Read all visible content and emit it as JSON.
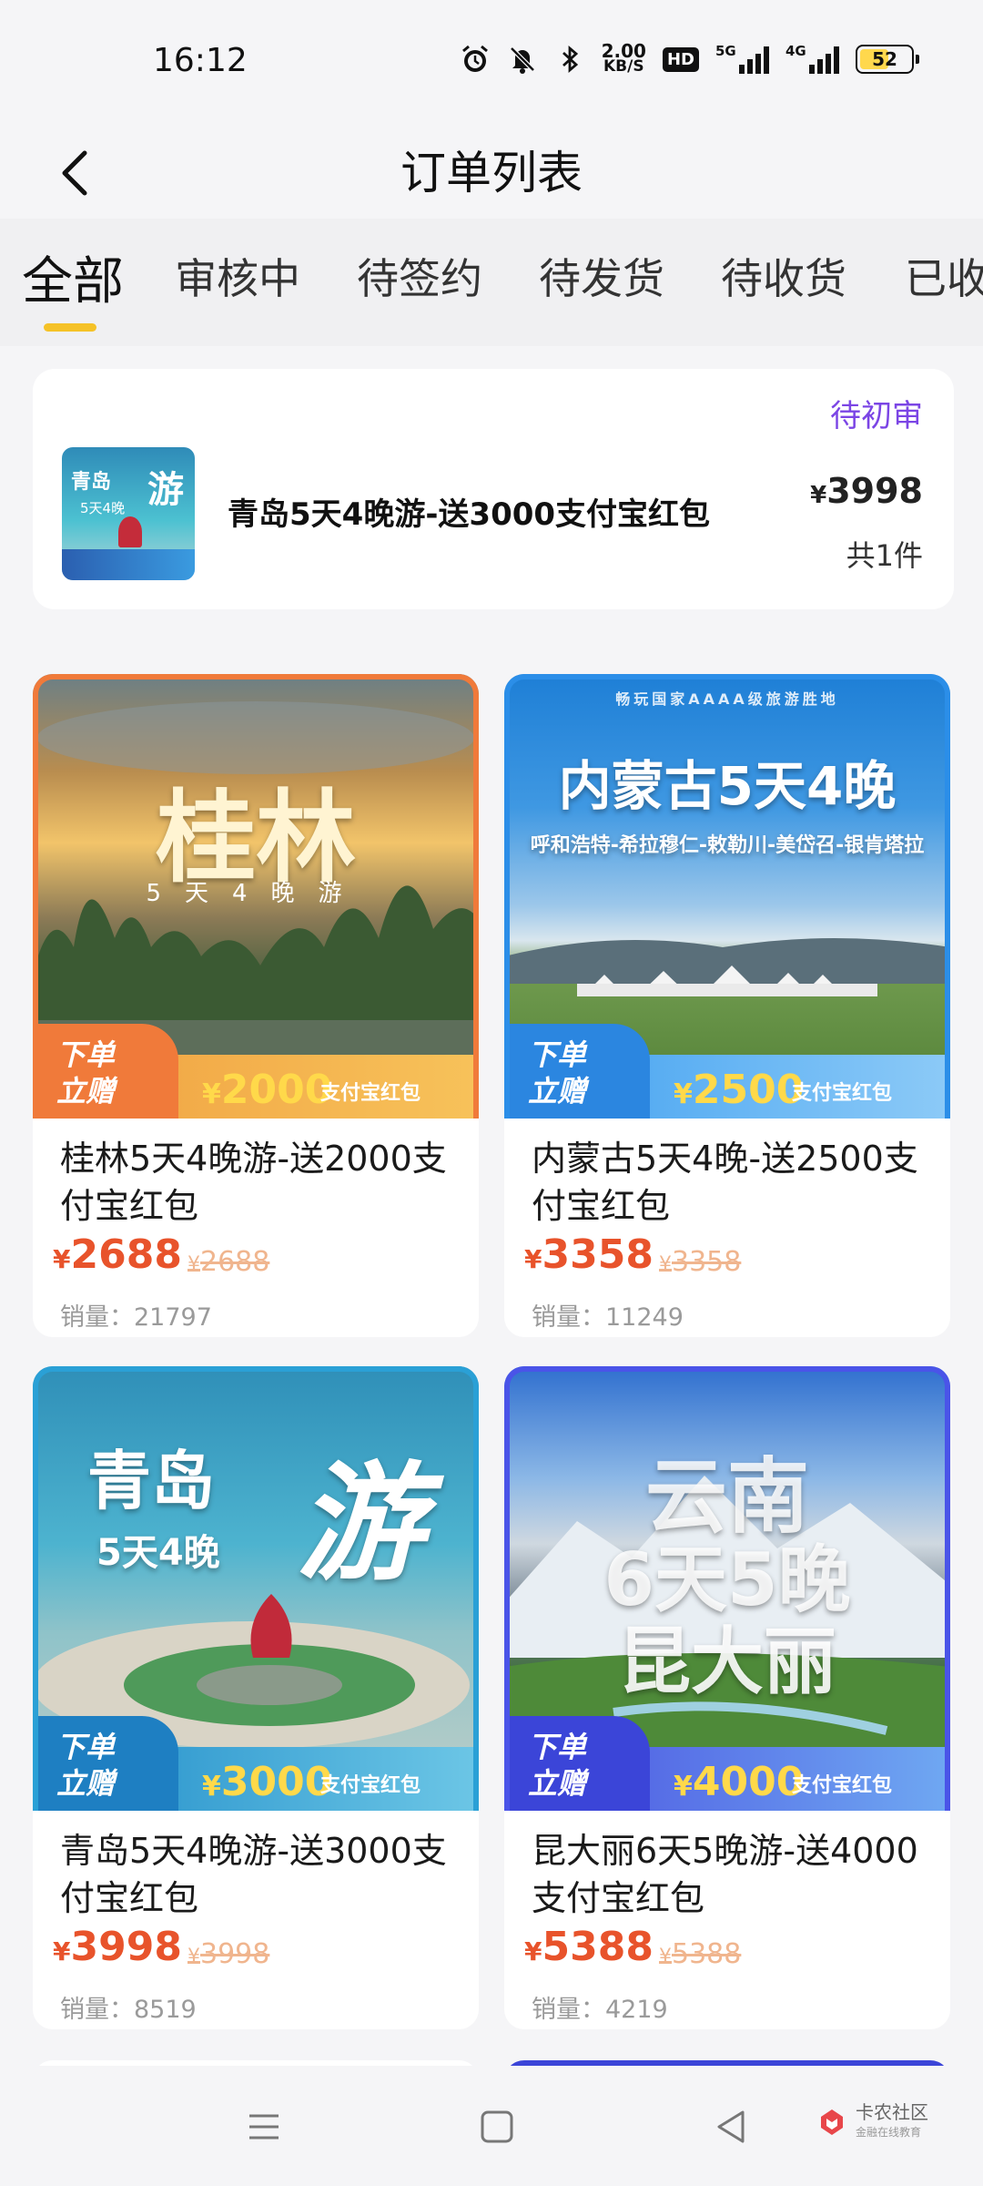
{
  "status_bar": {
    "time": "16:12",
    "net_speed_value": "2.00",
    "net_speed_unit": "KB/S",
    "hd_label": "HD",
    "sig1_gen": "5G",
    "sig2_gen": "4G",
    "battery": "52",
    "icons": [
      "alarm-icon",
      "mute-icon",
      "bluetooth-icon",
      "signal-icon",
      "battery-icon"
    ]
  },
  "header": {
    "title": "订单列表"
  },
  "tabs": [
    "全部",
    "审核中",
    "待签约",
    "待发货",
    "待收货",
    "已收"
  ],
  "active_tab": "全部",
  "order": {
    "status": "待初审",
    "name": "青岛5天4晚游-送3000支付宝红包",
    "currency": "¥",
    "price": "3998",
    "quantity": "共1件",
    "thumb_title": "游",
    "thumb_sub": "青岛",
    "thumb_days": "5天4晚"
  },
  "products": [
    {
      "art_title": "桂林",
      "art_sub": "5天4晚游",
      "badge": "下单\n立赠",
      "reward": "2000",
      "reward_label": "支付宝红包",
      "name": "桂林5天4晚游-送2000支付宝红包",
      "currency": "¥",
      "price": "2688",
      "original_price": "2688",
      "sales": "销量：21797",
      "accent": "#f07a3a"
    },
    {
      "art_top": "畅玩国家AAAA级旅游胜地",
      "art_title": "内蒙古5天4晚",
      "art_sub": "呼和浩特-希拉穆仁-敕勒川-美岱召-银肯塔拉",
      "badge": "下单\n立赠",
      "reward": "2500",
      "reward_label": "支付宝红包",
      "name": "内蒙古5天4晚-送2500支付宝红包",
      "currency": "¥",
      "price": "3358",
      "original_price": "3358",
      "sales": "销量：11249",
      "accent": "#2b8ee8"
    },
    {
      "art_title": "青岛",
      "art_title2": "游",
      "art_sub": "5天4晚",
      "badge": "下单\n立赠",
      "reward": "3000",
      "reward_label": "支付宝红包",
      "name": "青岛5天4晚游-送3000支付宝红包",
      "currency": "¥",
      "price": "3998",
      "original_price": "3998",
      "sales": "销量：8519",
      "accent": "#2aa0d6"
    },
    {
      "art_title": "云南",
      "art_sub": "6天5晚",
      "art_sub2": "昆大丽",
      "badge": "下单\n立赠",
      "reward": "4000",
      "reward_label": "支付宝红包",
      "name": "昆大丽6天5晚游-送4000支付宝红包",
      "currency": "¥",
      "price": "5388",
      "original_price": "5388",
      "sales": "销量：4219",
      "accent": "#4a54e8"
    }
  ],
  "nav": {
    "items": [
      "menu-icon",
      "home-icon",
      "back-icon"
    ],
    "watermark_title": "卡农社区",
    "watermark_sub": "金融在线教育"
  }
}
